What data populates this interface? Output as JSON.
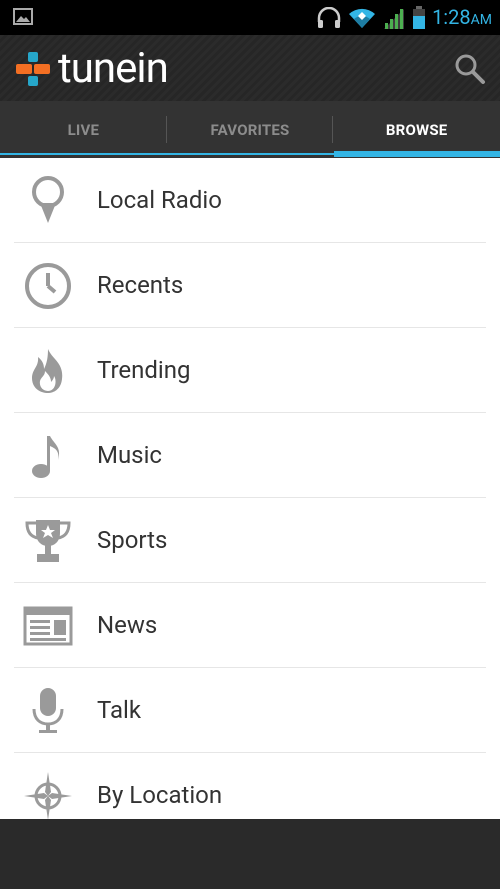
{
  "status_bar": {
    "time": "1:28",
    "ampm": "AM",
    "accent": "#33b5e5"
  },
  "app": {
    "brand": "tunein"
  },
  "tabs": [
    {
      "label": "LIVE",
      "active": false
    },
    {
      "label": "FAVORITES",
      "active": false
    },
    {
      "label": "BROWSE",
      "active": true
    }
  ],
  "browse": {
    "items": [
      {
        "label": "Local Radio",
        "icon": "map-pin-icon"
      },
      {
        "label": "Recents",
        "icon": "clock-icon"
      },
      {
        "label": "Trending",
        "icon": "fire-icon"
      },
      {
        "label": "Music",
        "icon": "music-note-icon"
      },
      {
        "label": "Sports",
        "icon": "trophy-icon"
      },
      {
        "label": "News",
        "icon": "newspaper-icon"
      },
      {
        "label": "Talk",
        "icon": "microphone-icon"
      },
      {
        "label": "By Location",
        "icon": "compass-icon"
      }
    ]
  }
}
